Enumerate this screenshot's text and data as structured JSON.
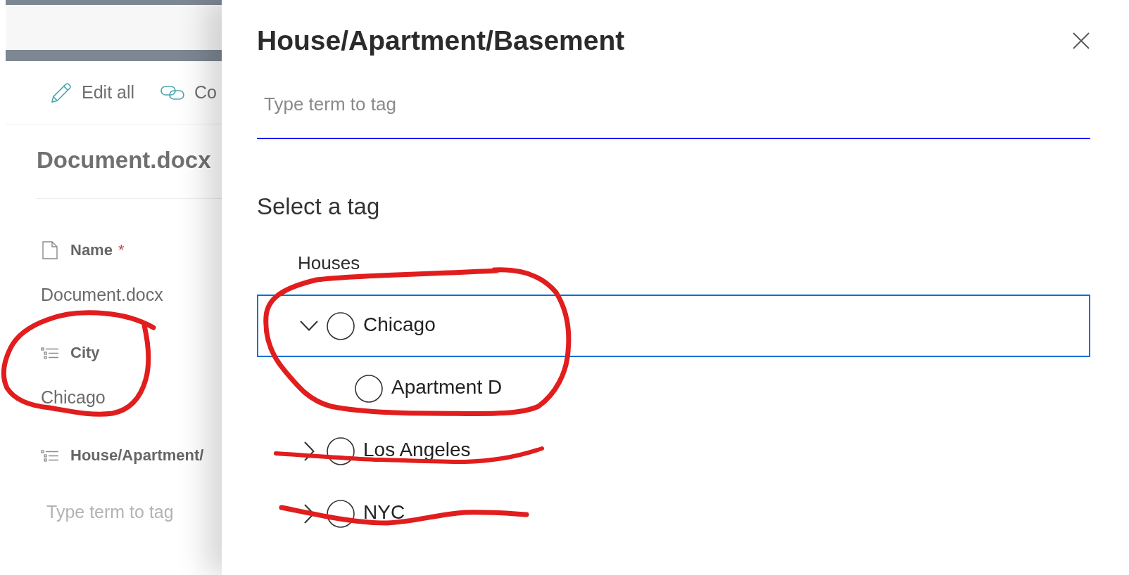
{
  "background_panel": {
    "toolbar": [
      {
        "label": "Edit all"
      },
      {
        "label": "Co"
      }
    ],
    "title": "Document.docx",
    "fields": [
      {
        "kind": "text",
        "label": "Name",
        "required_mark": "*",
        "value": "Document.docx"
      },
      {
        "kind": "taxonomy",
        "label": "City",
        "value": "Chicago"
      },
      {
        "kind": "taxonomy",
        "label": "House/Apartment/",
        "placeholder": "Type term to tag"
      }
    ]
  },
  "dialog": {
    "title": "House/Apartment/Basement",
    "search": {
      "placeholder": "Type term to tag"
    },
    "section_title": "Select a tag",
    "term_set": "Houses",
    "terms": [
      {
        "label": "Chicago",
        "expanded": true,
        "selected": true,
        "checked": false,
        "children": [
          {
            "label": "Apartment D",
            "selected": false,
            "checked": false
          }
        ]
      },
      {
        "label": "Los Angeles",
        "expanded": false,
        "selected": false,
        "checked": false
      },
      {
        "label": "NYC",
        "expanded": false,
        "selected": false,
        "checked": false
      }
    ]
  }
}
